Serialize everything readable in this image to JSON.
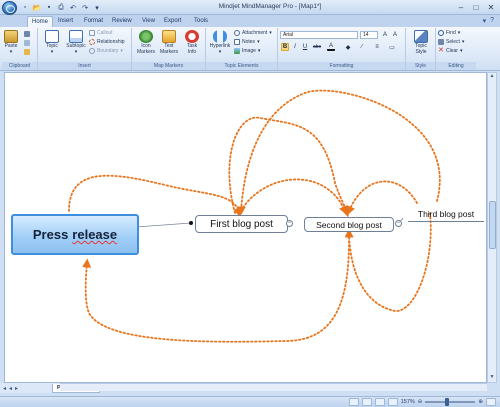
{
  "window": {
    "title": "Mindjet MindManager Pro - [Map1*]",
    "quick_access": [
      "new-icon",
      "open-icon",
      "save-icon",
      "print-icon",
      "undo-icon",
      "redo-icon",
      "more-icon"
    ]
  },
  "tabs": [
    {
      "label": "Home",
      "active": true
    },
    {
      "label": "Insert",
      "active": false
    },
    {
      "label": "Format",
      "active": false
    },
    {
      "label": "Review",
      "active": false
    },
    {
      "label": "View",
      "active": false
    },
    {
      "label": "Export",
      "active": false
    },
    {
      "label": "Tools",
      "active": false
    }
  ],
  "ribbon": {
    "clipboard": {
      "label": "Clipboard",
      "paste": "Paste"
    },
    "insert": {
      "label": "Insert",
      "topic": "Topic",
      "subtopic": "Subtopic",
      "callout": "Callout",
      "relationship": "Relationship",
      "boundary": "Boundary"
    },
    "map_markers": {
      "label": "Map Markers",
      "icon_markers_1": "Icon",
      "icon_markers_2": "Markers",
      "text_markers_1": "Text",
      "text_markers_2": "Markers",
      "task_info_1": "Task",
      "task_info_2": "Info"
    },
    "topic_elements": {
      "label": "Topic Elements",
      "hyperlink": "Hyperlink",
      "attachment": "Attachment",
      "notes": "Notes",
      "image": "Image"
    },
    "formatting": {
      "label": "Formatting",
      "font": "Arial",
      "size": "14",
      "bold": "B",
      "italic": "I",
      "underline": "U",
      "strike": "abc",
      "font_color": "A"
    },
    "style": {
      "label": "Style",
      "topic_style_1": "Topic",
      "topic_style_2": "Style"
    },
    "editing": {
      "label": "Editing",
      "find": "Find",
      "select": "Select",
      "clear": "Clear"
    }
  },
  "map": {
    "central_topic": {
      "word1": "Press",
      "word2": "release"
    },
    "topics": [
      {
        "label": "First blog post"
      },
      {
        "label": "Second blog post"
      },
      {
        "label": "Third blog post"
      }
    ],
    "relationship_color": "#e8741c",
    "central_fill": "#9ecdf6"
  },
  "sheets": {
    "nav": [
      "first-icon",
      "prev-icon",
      "next-icon",
      "last-icon"
    ],
    "active": "Press release*"
  },
  "status": {
    "zoom": "157%"
  },
  "colors": {
    "ribbon_bg": "#dce8f7",
    "accent": "#3f8fe0",
    "relationship": "#e8741c"
  }
}
